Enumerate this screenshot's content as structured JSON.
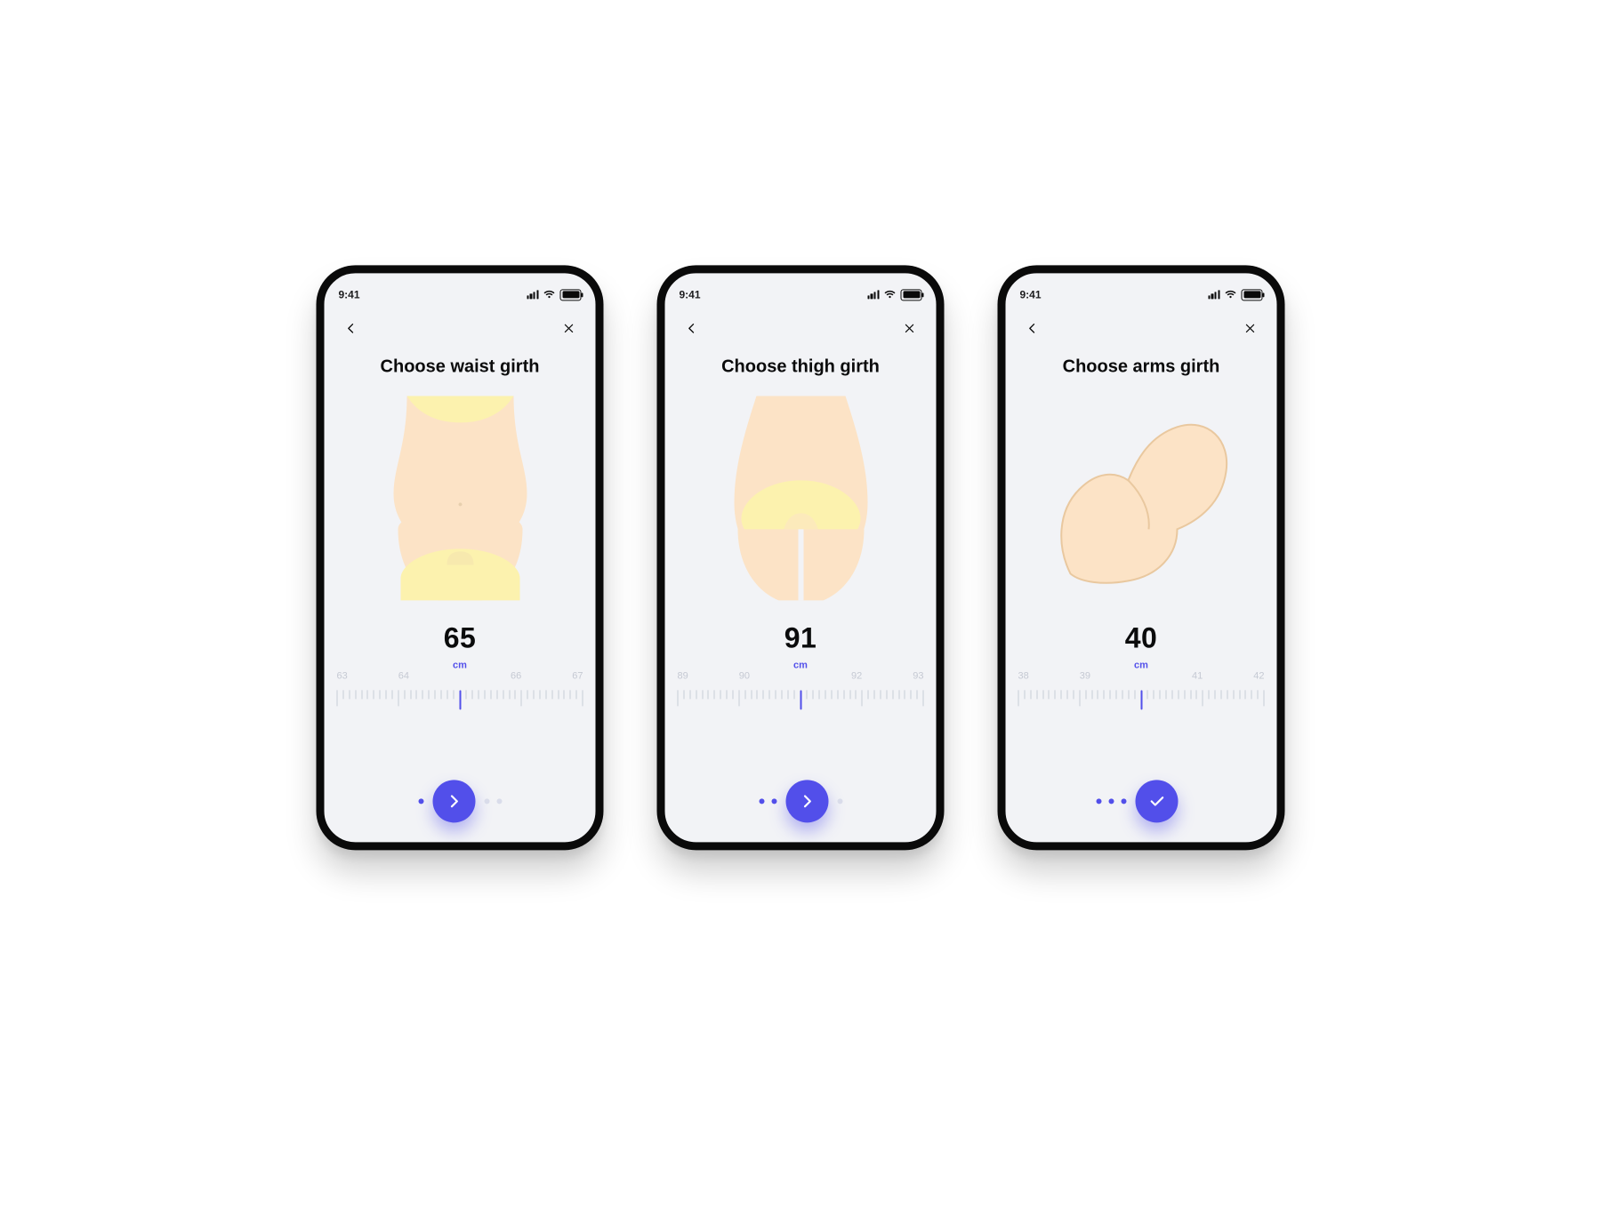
{
  "status_time": "9:41",
  "colors": {
    "accent": "#524fea"
  },
  "screens": [
    {
      "title": "Choose waist girth",
      "value": "65",
      "unit": "cm",
      "ruler_labels": [
        "63",
        "64",
        "",
        "66",
        "67"
      ],
      "progress": {
        "active": 1,
        "total": 4
      },
      "next_icon": "chevron"
    },
    {
      "title": "Choose thigh girth",
      "value": "91",
      "unit": "cm",
      "ruler_labels": [
        "89",
        "90",
        "",
        "92",
        "93"
      ],
      "progress": {
        "active": 2,
        "total": 4
      },
      "next_icon": "chevron"
    },
    {
      "title": "Choose arms girth",
      "value": "40",
      "unit": "cm",
      "ruler_labels": [
        "38",
        "39",
        "",
        "41",
        "42"
      ],
      "progress": {
        "active": 3,
        "total": 4
      },
      "next_icon": "check"
    }
  ]
}
